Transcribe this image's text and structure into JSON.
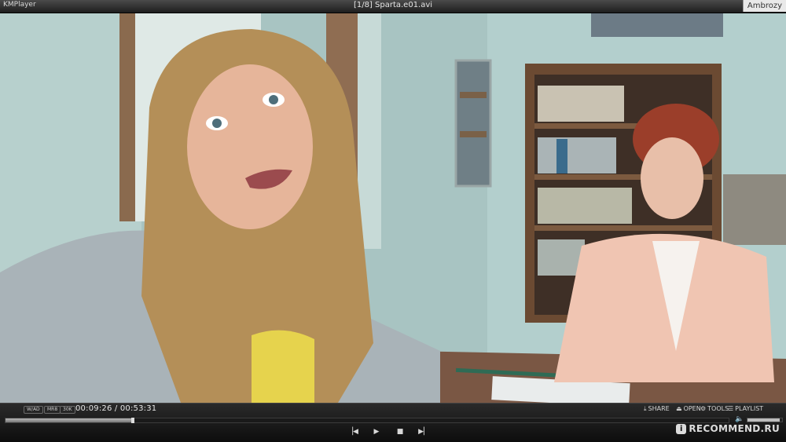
{
  "titlebar": {
    "app_name": "KMPlayer",
    "file_title": "[1/8] Sparta.e01.avi",
    "user": "Ambrozy"
  },
  "status": {
    "tags": [
      "W/AD",
      "MR8",
      "30K"
    ],
    "time": "00:09:26 / 00:53:31"
  },
  "menu": {
    "share": "SHARE",
    "open": "OPEN",
    "tools": "TOOLS",
    "playlist": "PLAYLIST"
  },
  "icons": {
    "share": "download-icon",
    "open": "eject-icon",
    "tools": "gear-icon",
    "playlist": "list-icon",
    "volume": "speaker-icon",
    "prev": "skip-back-icon",
    "play": "play-icon",
    "stop": "stop-icon",
    "next": "skip-forward-icon"
  },
  "progress": {
    "fraction": 0.176
  },
  "volume": {
    "fraction": 0.93
  },
  "watermark": {
    "badge": "i",
    "text": "RECOMMEND.RU"
  },
  "colors": {
    "panel": "#1a1a1a",
    "text": "#d8d8d8"
  }
}
